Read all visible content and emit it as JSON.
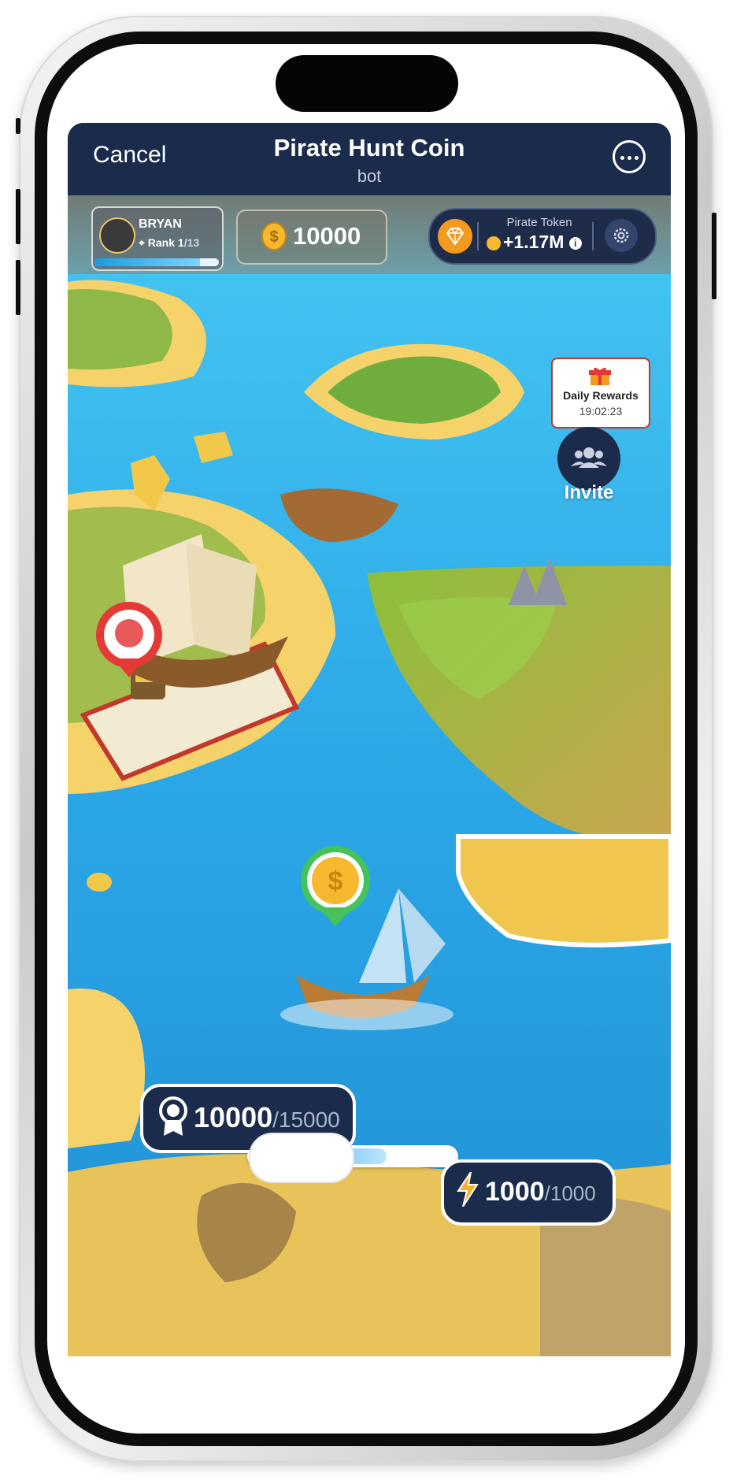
{
  "nav": {
    "cancel_label": "Cancel",
    "title": "Pirate Hunt Coin",
    "subtitle": "bot",
    "more_icon": "more-horizontal-icon"
  },
  "player": {
    "name": "BRYAN",
    "rank_label": "Rank",
    "rank_current": "1",
    "rank_total": "/13",
    "avatar_icon": "pirate-avatar-icon",
    "rank_progress": 0.85
  },
  "coins": {
    "balance": "10000",
    "icon": "dollar-coin-icon"
  },
  "token": {
    "label": "Pirate Token",
    "value": "+1.17M",
    "diamond_icon": "diamond-icon",
    "info_icon": "info-icon",
    "settings_icon": "gear-icon"
  },
  "daily_rewards": {
    "label": "Daily Rewards",
    "timer": "19:02:23",
    "icon": "gift-icon"
  },
  "invite": {
    "label": "Invite",
    "icon": "users-icon"
  },
  "xp": {
    "current": "10000",
    "max": "/15000",
    "icon": "award-ribbon-icon",
    "progress": 0.667
  },
  "energy": {
    "current": "1000",
    "max": "/1000",
    "icon": "lightning-icon"
  },
  "colors": {
    "nav_bg": "#1b2b4b",
    "ocean": "#2aa5e6",
    "sand": "#f2c84b",
    "accent_orange": "#f39a1f",
    "pin_red": "#e53935",
    "pin_green": "#43c35a"
  }
}
